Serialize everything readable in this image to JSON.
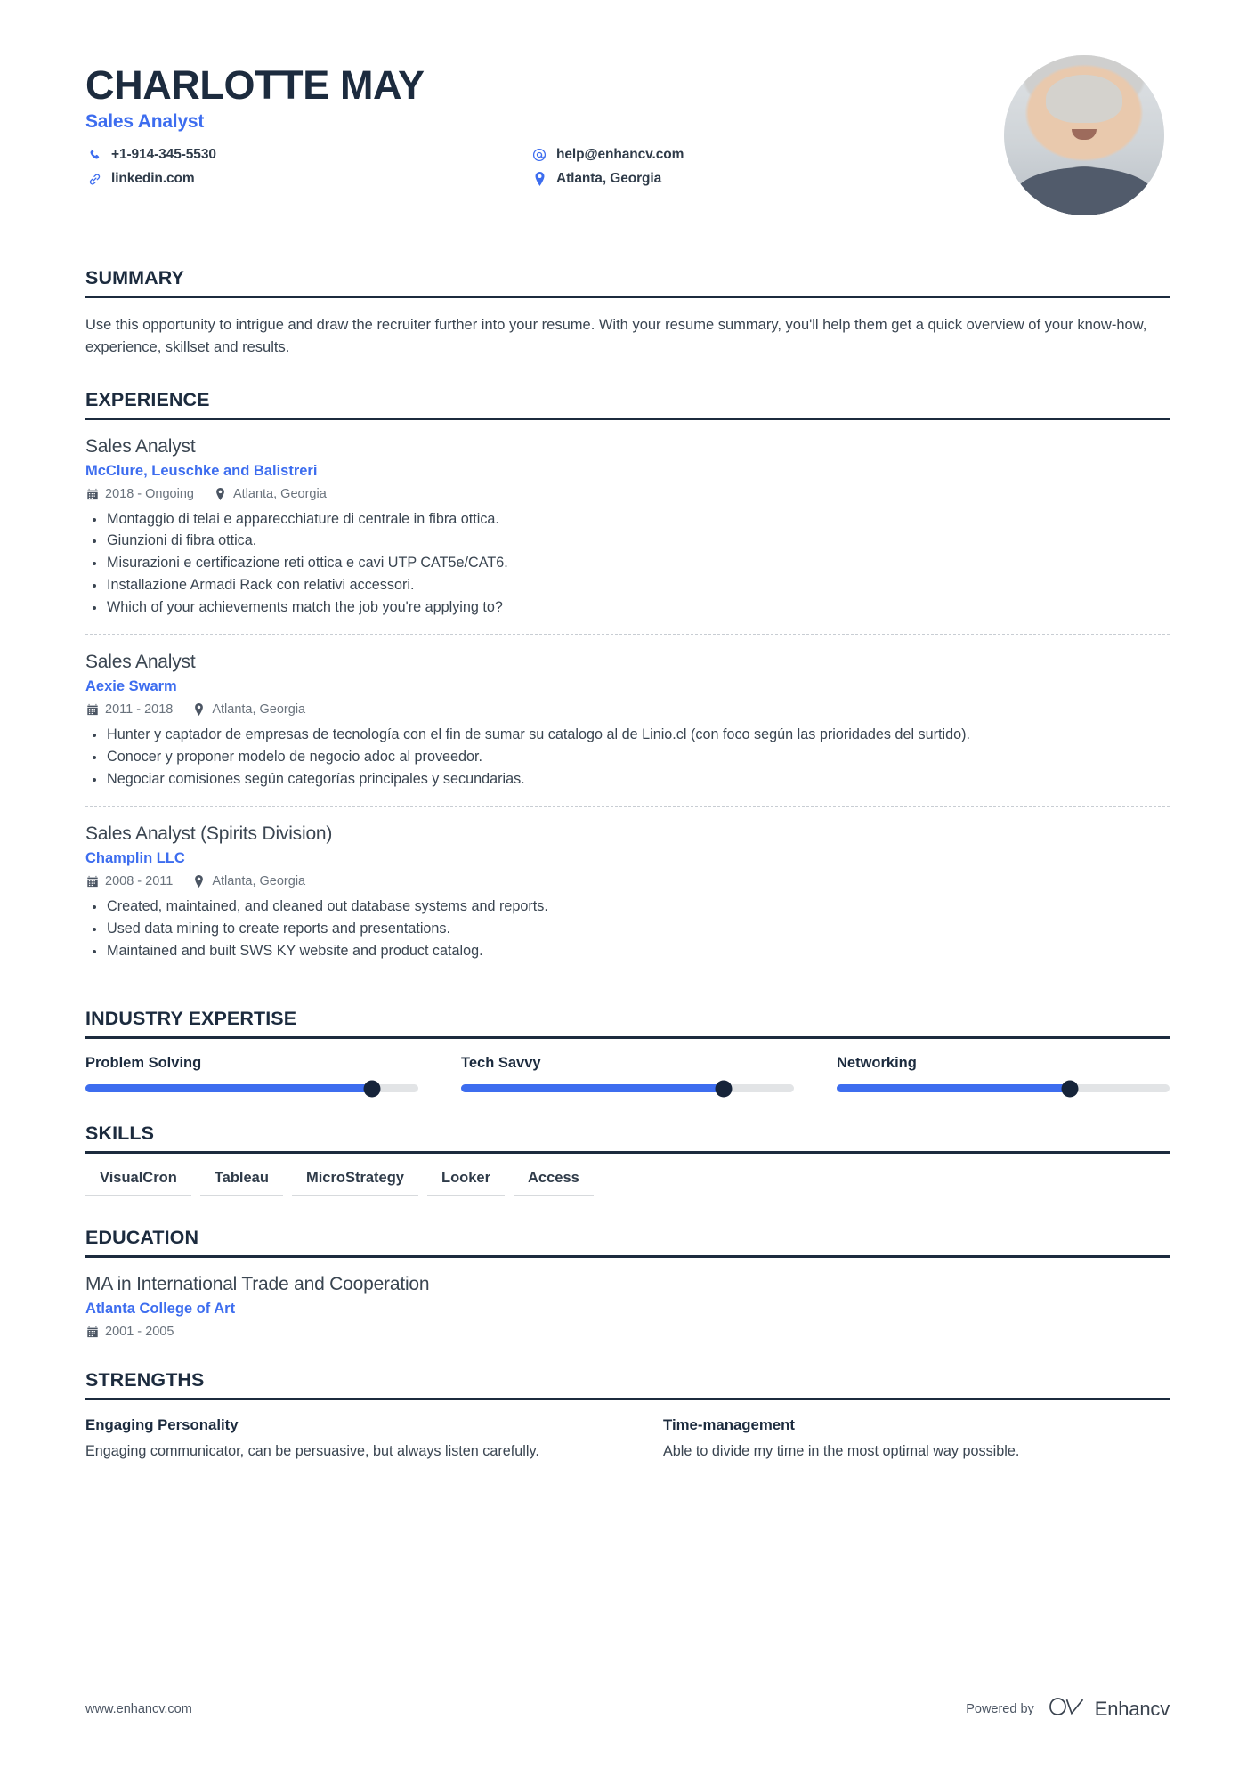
{
  "header": {
    "full_name": "CHARLOTTE MAY",
    "job_title": "Sales Analyst",
    "contacts": [
      {
        "icon": "phone-icon",
        "value": "+1-914-345-5530"
      },
      {
        "icon": "at-icon",
        "value": "help@enhancv.com"
      },
      {
        "icon": "link-icon",
        "value": "linkedin.com"
      },
      {
        "icon": "location-pin-icon",
        "value": "Atlanta, Georgia"
      }
    ],
    "avatar_alt": "profile-photo"
  },
  "sections": {
    "summary": {
      "title": "SUMMARY",
      "text": "Use this opportunity to intrigue and draw the recruiter further into your resume. With your resume summary, you'll help them get a quick overview of your know-how, experience, skillset and results."
    },
    "experience": {
      "title": "EXPERIENCE",
      "jobs": [
        {
          "role": "Sales Analyst",
          "company": "McClure, Leuschke and Balistreri",
          "dates": "2018 - Ongoing",
          "location": "Atlanta, Georgia",
          "bullets": [
            "Montaggio di telai e apparecchiature di centrale in fibra ottica.",
            "Giunzioni di fibra ottica.",
            "Misurazioni e certificazione reti ottica e cavi UTP CAT5e/CAT6.",
            "Installazione Armadi Rack con relativi accessori.",
            "Which of your achievements match the job you're applying to?"
          ]
        },
        {
          "role": "Sales Analyst",
          "company": "Aexie Swarm",
          "dates": "2011 - 2018",
          "location": "Atlanta, Georgia",
          "bullets": [
            "Hunter y captador de empresas de tecnología con el fin de sumar su catalogo al de Linio.cl (con foco según las prioridades del surtido).",
            "Conocer y proponer modelo de negocio adoc al proveedor.",
            "Negociar comisiones según categorías principales y secundarias."
          ]
        },
        {
          "role": "Sales Analyst (Spirits Division)",
          "company": "Champlin LLC",
          "dates": "2008 - 2011",
          "location": "Atlanta, Georgia",
          "bullets": [
            "Created, maintained, and cleaned out database systems and reports.",
            "Used data mining to create reports and presentations.",
            "Maintained and built SWS KY website and product catalog."
          ]
        }
      ]
    },
    "industry_expertise": {
      "title": "INDUSTRY EXPERTISE",
      "items": [
        {
          "label": "Problem Solving",
          "percent": 86
        },
        {
          "label": "Tech Savvy",
          "percent": 79
        },
        {
          "label": "Networking",
          "percent": 70
        }
      ]
    },
    "skills": {
      "title": "SKILLS",
      "items": [
        "VisualCron",
        "Tableau",
        "MicroStrategy",
        "Looker",
        "Access"
      ]
    },
    "education": {
      "title": "EDUCATION",
      "entries": [
        {
          "degree": "MA in International Trade and Cooperation",
          "school": "Atlanta College of Art",
          "dates": "2001 - 2005"
        }
      ]
    },
    "strengths": {
      "title": "STRENGTHS",
      "items": [
        {
          "title": "Engaging Personality",
          "description": "Engaging communicator, can be persuasive, but always listen carefully."
        },
        {
          "title": "Time-management",
          "description": "Able to divide my time in the most optimal way possible."
        }
      ]
    }
  },
  "footer": {
    "url": "www.enhancv.com",
    "powered_by": "Powered by",
    "brand_name": "Enhancv"
  },
  "colors": {
    "accent_blue": "#3d6def",
    "dark_navy": "#1c2b3e",
    "body_text": "#3a4551",
    "muted": "#6a737d",
    "track": "#e2e4e6",
    "knob": "#16243a"
  }
}
